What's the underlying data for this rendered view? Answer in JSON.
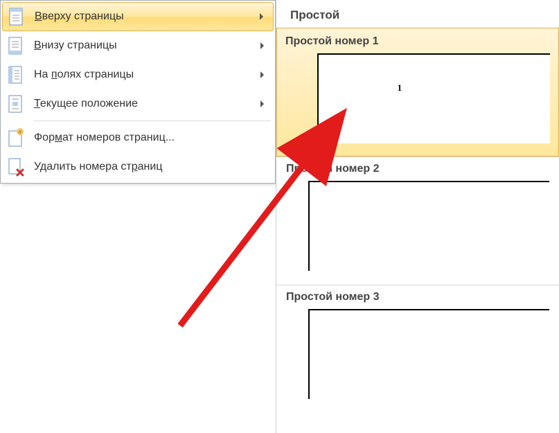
{
  "menu": {
    "items": [
      {
        "label_pre": "",
        "label_u": "В",
        "label_post": "верху страницы",
        "has_arrow": true,
        "highlighted": true
      },
      {
        "label_pre": "",
        "label_u": "В",
        "label_post": "низу страницы",
        "has_arrow": true,
        "highlighted": false
      },
      {
        "label_pre": "На ",
        "label_u": "п",
        "label_post": "олях страницы",
        "has_arrow": true,
        "highlighted": false
      },
      {
        "label_pre": "",
        "label_u": "Т",
        "label_post": "екущее положение",
        "has_arrow": true,
        "highlighted": false
      },
      {
        "label_pre": "Фор",
        "label_u": "м",
        "label_post": "ат номеров страниц...",
        "has_arrow": false,
        "highlighted": false
      },
      {
        "label_pre": "Удалить номера ст",
        "label_u": "р",
        "label_post": "аниц",
        "has_arrow": false,
        "highlighted": false
      }
    ]
  },
  "gallery": {
    "header": "Простой",
    "items": [
      {
        "title": "Простой номер 1",
        "highlighted": true,
        "page_num": "1"
      },
      {
        "title": "Простой номер 2",
        "highlighted": false,
        "page_num": ""
      },
      {
        "title": "Простой номер 3",
        "highlighted": false,
        "page_num": ""
      }
    ]
  }
}
